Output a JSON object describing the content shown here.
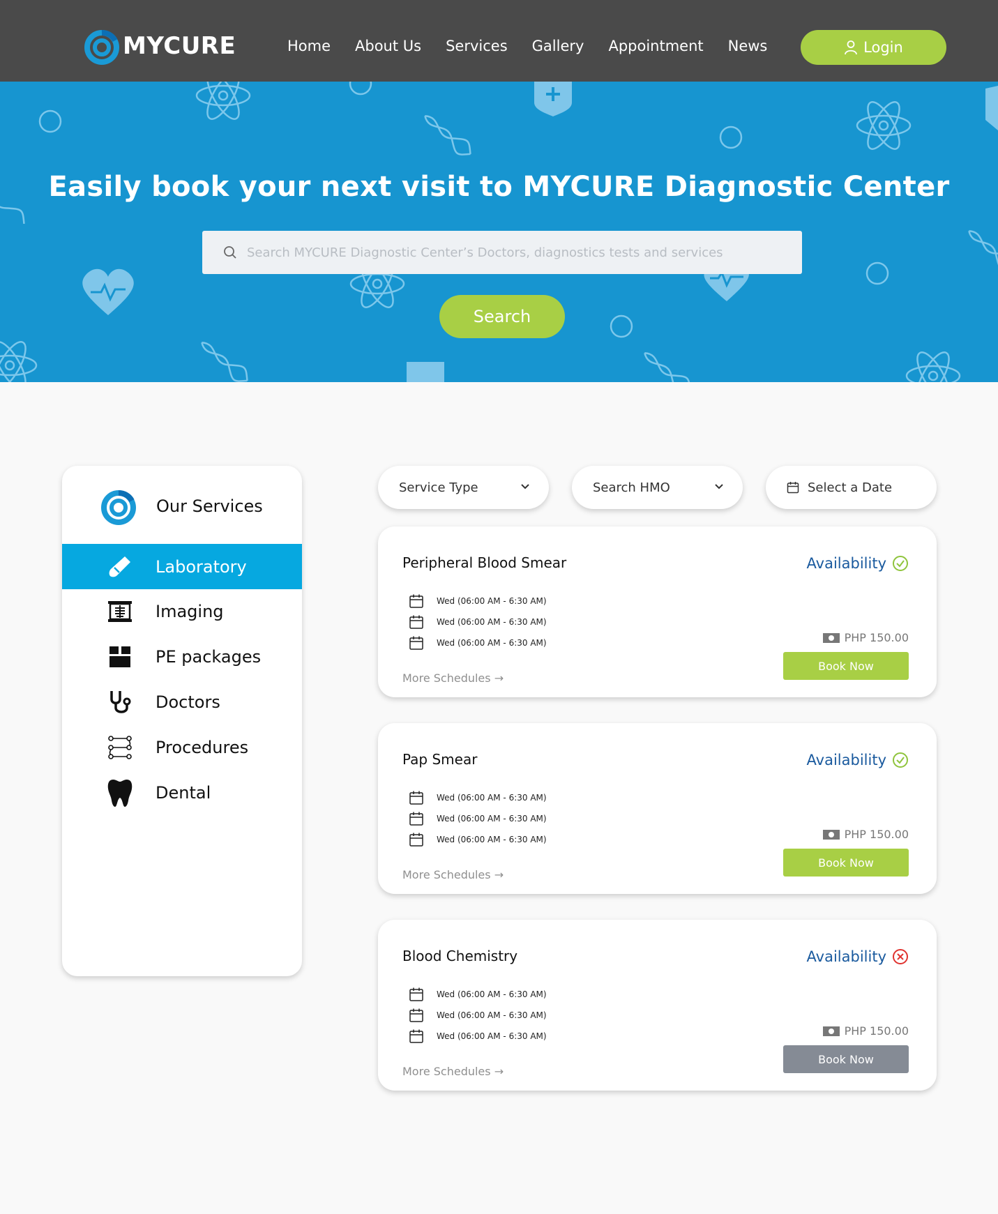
{
  "header": {
    "brand": "MYCURE",
    "nav": [
      "Home",
      "About Us",
      "Services",
      "Gallery",
      "Appointment",
      "News"
    ],
    "login_label": "Login"
  },
  "hero": {
    "title": "Easily book your next visit to MYCURE Diagnostic Center",
    "search_placeholder": "Search MYCURE Diagnostic Center’s Doctors, diagnostics tests and services",
    "search_button": "Search"
  },
  "sidebar": {
    "title": "Our Services",
    "items": [
      {
        "label": "Laboratory",
        "icon": "test-tube-icon",
        "active": true
      },
      {
        "label": "Imaging",
        "icon": "xray-icon",
        "active": false
      },
      {
        "label": "PE packages",
        "icon": "box-icon",
        "active": false
      },
      {
        "label": "Doctors",
        "icon": "stethoscope-icon",
        "active": false
      },
      {
        "label": "Procedures",
        "icon": "flowchart-icon",
        "active": false
      },
      {
        "label": "Dental",
        "icon": "tooth-icon",
        "active": false
      }
    ]
  },
  "filters": {
    "service_type": "Service Type",
    "hmo": "Search HMO",
    "date": "Select a Date"
  },
  "services": [
    {
      "name": "Peripheral Blood Smear",
      "availability_label": "Availability",
      "available": true,
      "schedules": [
        "Wed (06:00 AM - 6:30 AM)",
        "Wed (06:00 AM - 6:30 AM)",
        "Wed (06:00 AM - 6:30 AM)"
      ],
      "more_label": "More Schedules →",
      "price": "PHP 150.00",
      "book_label": "Book Now"
    },
    {
      "name": "Pap Smear",
      "availability_label": "Availability",
      "available": true,
      "schedules": [
        "Wed (06:00 AM - 6:30 AM)",
        "Wed (06:00 AM - 6:30 AM)",
        "Wed (06:00 AM - 6:30 AM)"
      ],
      "more_label": "More Schedules →",
      "price": "PHP 150.00",
      "book_label": "Book Now"
    },
    {
      "name": "Blood Chemistry",
      "availability_label": "Availability",
      "available": false,
      "schedules": [
        "Wed (06:00 AM - 6:30 AM)",
        "Wed (06:00 AM - 6:30 AM)",
        "Wed (06:00 AM - 6:30 AM)"
      ],
      "more_label": "More Schedules →",
      "price": "PHP 150.00",
      "book_label": "Book Now"
    }
  ],
  "colors": {
    "nav_bg": "#4a4a4a",
    "hero_bg": "#1795d0",
    "accent_green": "#a8cf45",
    "active_blue": "#06a8e0",
    "availability_text": "#1a5a9e",
    "available_icon": "#8fc43c",
    "unavailable_icon": "#e0332f",
    "disabled_button": "#858b95"
  }
}
